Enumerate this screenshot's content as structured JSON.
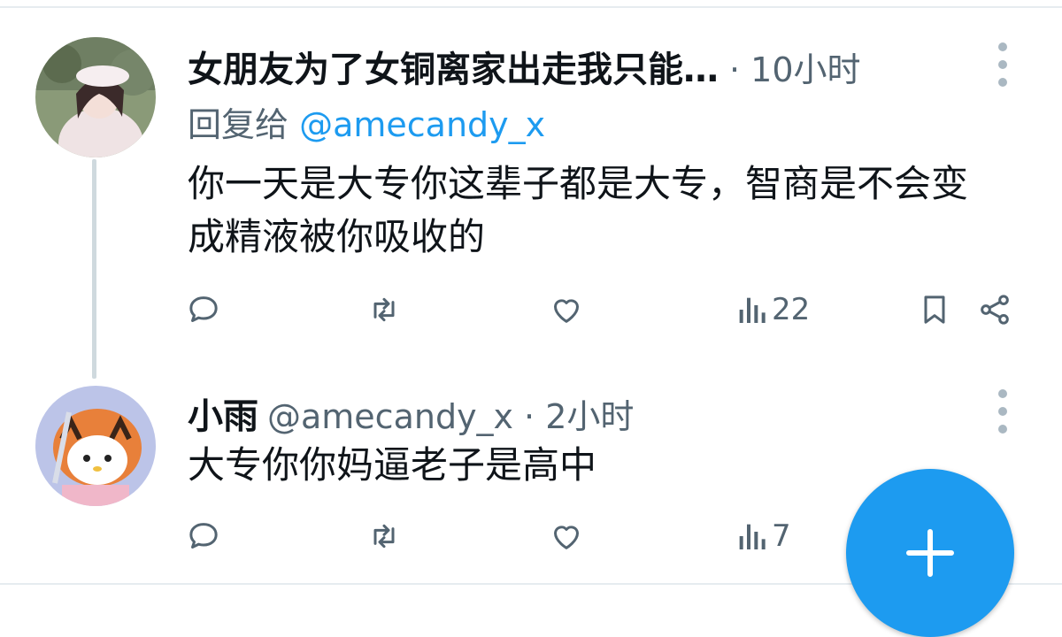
{
  "tweet1": {
    "name": "女朋友为了女铜离家出走我只能…",
    "time": "· 10小时",
    "reply_prefix": "回复给",
    "reply_handle": "@amecandy_x",
    "text": "你一天是大专你这辈子都是大专，智商是不会变成精液被你吸收的",
    "views": "22",
    "icons": [
      "more-icon",
      "reply-icon",
      "retweet-icon",
      "like-icon",
      "views-icon",
      "bookmark-icon",
      "share-icon"
    ]
  },
  "tweet2": {
    "name": "小雨",
    "handle": "@amecandy_x",
    "time": "· 2小时",
    "text": "大专你你妈逼老子是高中",
    "views": "7",
    "icons": [
      "more-icon",
      "reply-icon",
      "retweet-icon",
      "like-icon",
      "views-icon"
    ]
  },
  "fab": {
    "icon": "plus-icon"
  },
  "colors": {
    "accent": "#1d9bf0",
    "muted": "#536471",
    "text": "#0f1419",
    "divider": "#e6ecf0"
  }
}
